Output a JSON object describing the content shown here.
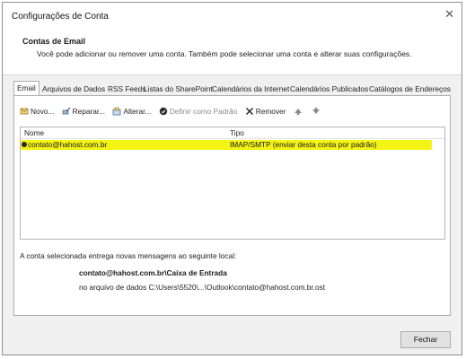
{
  "window": {
    "title": "Configurações de Conta",
    "close_glyph": "✕"
  },
  "header": {
    "title": "Contas de Email",
    "description": "Você pode adicionar ou remover uma conta. Também pode selecionar uma conta e alterar suas configurações."
  },
  "tabs": [
    {
      "label": "Email",
      "active": true
    },
    {
      "label": "Arquivos de Dados"
    },
    {
      "label": "RSS Feeds"
    },
    {
      "label": "Listas do SharePoint"
    },
    {
      "label": "Calendários da Internet"
    },
    {
      "label": "Calendários Publicados"
    },
    {
      "label": "Catálogos de Endereços"
    }
  ],
  "toolbar": {
    "new_label": "Novo...",
    "repair_label": "Reparar...",
    "change_label": "Alterar...",
    "default_label": "Definir como Padrão",
    "remove_label": "Remover"
  },
  "list": {
    "headers": {
      "name": "Nome",
      "type": "Tipo"
    },
    "rows": [
      {
        "name": "contato@hahost.com.br",
        "type": "IMAP/SMTP (enviar desta conta por padrão)"
      }
    ]
  },
  "details": {
    "info": "A conta selecionada entrega novas mensagens ao seguinte local:",
    "account_folder": "contato@hahost.com.br\\Caixa de Entrada",
    "data_file": "no arquivo de dados C:\\Users\\5520\\...\\Outlook\\contato@hahost.com.br.ost"
  },
  "footer": {
    "close_label": "Fechar"
  },
  "colors": {
    "highlight": "#f3f314"
  }
}
